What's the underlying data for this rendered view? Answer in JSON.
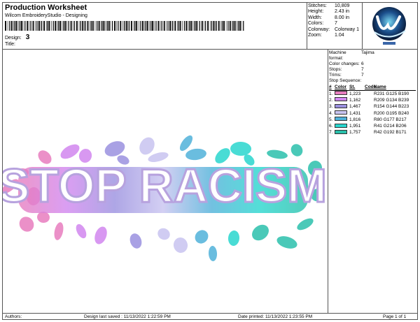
{
  "header": {
    "title": "Production Worksheet",
    "subtitle": "Wilcom EmbroideryStudio - Designing",
    "design_label": "Design:",
    "design_value": "3",
    "title_label": "Title:"
  },
  "stats": [
    {
      "label": "Stitches:",
      "value": "10,809"
    },
    {
      "label": "Height:",
      "value": "2.43 in"
    },
    {
      "label": "Width:",
      "value": "8.00 in"
    },
    {
      "label": "Colors:",
      "value": "7"
    },
    {
      "label": "Colorway:",
      "value": "Colorway 1"
    },
    {
      "label": "Zoom:",
      "value": "1.04"
    }
  ],
  "machine": [
    {
      "label": "Machine format:",
      "value": "Tajima"
    },
    {
      "label": "Color changes:",
      "value": "6"
    },
    {
      "label": "Stops:",
      "value": "7"
    },
    {
      "label": "Trims:",
      "value": "7"
    }
  ],
  "stop_sequence": {
    "label": "Stop Sequence:",
    "headers": [
      "#",
      "Color",
      "St.",
      "Code",
      "Name"
    ],
    "rows": [
      {
        "n": "1.",
        "color": "#E77DBE",
        "st": "1,223",
        "code": "",
        "name": "R231 G125 B190"
      },
      {
        "n": "2.",
        "color": "#D186EF",
        "st": "1,162",
        "code": "",
        "name": "R209 G134 B239"
      },
      {
        "n": "3.",
        "color": "#9A90DF",
        "st": "1,467",
        "code": "",
        "name": "R154 G144 B223"
      },
      {
        "n": "4.",
        "color": "#C8C3F0",
        "st": "1,431",
        "code": "",
        "name": "R200 G195 B240"
      },
      {
        "n": "5.",
        "color": "#50B1D9",
        "st": "1,816",
        "code": "",
        "name": "R80 G177 B217"
      },
      {
        "n": "6.",
        "color": "#29D6CE",
        "st": "1,951",
        "code": "",
        "name": "R41 G214 B206"
      },
      {
        "n": "7.",
        "color": "#2AC0AB",
        "st": "1,757",
        "code": "",
        "name": "R42 G192 B171"
      }
    ]
  },
  "design_text": "STOP RACISM",
  "footer": {
    "authors": "Authors:",
    "last_saved": "Design last saved : 11/13/2022 1:22:59 PM",
    "printed": "Date printed: 11/13/2022 1:23:55 PM",
    "page": "Page 1 of 1"
  }
}
